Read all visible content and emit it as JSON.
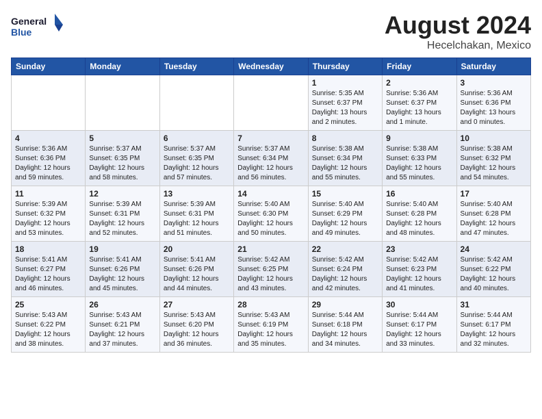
{
  "logo": {
    "line1": "General",
    "line2": "Blue"
  },
  "title": {
    "month_year": "August 2024",
    "location": "Hecelchakan, Mexico"
  },
  "days_of_week": [
    "Sunday",
    "Monday",
    "Tuesday",
    "Wednesday",
    "Thursday",
    "Friday",
    "Saturday"
  ],
  "weeks": [
    [
      {
        "day": "",
        "info": ""
      },
      {
        "day": "",
        "info": ""
      },
      {
        "day": "",
        "info": ""
      },
      {
        "day": "",
        "info": ""
      },
      {
        "day": "1",
        "info": "Sunrise: 5:35 AM\nSunset: 6:37 PM\nDaylight: 13 hours\nand 2 minutes."
      },
      {
        "day": "2",
        "info": "Sunrise: 5:36 AM\nSunset: 6:37 PM\nDaylight: 13 hours\nand 1 minute."
      },
      {
        "day": "3",
        "info": "Sunrise: 5:36 AM\nSunset: 6:36 PM\nDaylight: 13 hours\nand 0 minutes."
      }
    ],
    [
      {
        "day": "4",
        "info": "Sunrise: 5:36 AM\nSunset: 6:36 PM\nDaylight: 12 hours\nand 59 minutes."
      },
      {
        "day": "5",
        "info": "Sunrise: 5:37 AM\nSunset: 6:35 PM\nDaylight: 12 hours\nand 58 minutes."
      },
      {
        "day": "6",
        "info": "Sunrise: 5:37 AM\nSunset: 6:35 PM\nDaylight: 12 hours\nand 57 minutes."
      },
      {
        "day": "7",
        "info": "Sunrise: 5:37 AM\nSunset: 6:34 PM\nDaylight: 12 hours\nand 56 minutes."
      },
      {
        "day": "8",
        "info": "Sunrise: 5:38 AM\nSunset: 6:34 PM\nDaylight: 12 hours\nand 55 minutes."
      },
      {
        "day": "9",
        "info": "Sunrise: 5:38 AM\nSunset: 6:33 PM\nDaylight: 12 hours\nand 55 minutes."
      },
      {
        "day": "10",
        "info": "Sunrise: 5:38 AM\nSunset: 6:32 PM\nDaylight: 12 hours\nand 54 minutes."
      }
    ],
    [
      {
        "day": "11",
        "info": "Sunrise: 5:39 AM\nSunset: 6:32 PM\nDaylight: 12 hours\nand 53 minutes."
      },
      {
        "day": "12",
        "info": "Sunrise: 5:39 AM\nSunset: 6:31 PM\nDaylight: 12 hours\nand 52 minutes."
      },
      {
        "day": "13",
        "info": "Sunrise: 5:39 AM\nSunset: 6:31 PM\nDaylight: 12 hours\nand 51 minutes."
      },
      {
        "day": "14",
        "info": "Sunrise: 5:40 AM\nSunset: 6:30 PM\nDaylight: 12 hours\nand 50 minutes."
      },
      {
        "day": "15",
        "info": "Sunrise: 5:40 AM\nSunset: 6:29 PM\nDaylight: 12 hours\nand 49 minutes."
      },
      {
        "day": "16",
        "info": "Sunrise: 5:40 AM\nSunset: 6:28 PM\nDaylight: 12 hours\nand 48 minutes."
      },
      {
        "day": "17",
        "info": "Sunrise: 5:40 AM\nSunset: 6:28 PM\nDaylight: 12 hours\nand 47 minutes."
      }
    ],
    [
      {
        "day": "18",
        "info": "Sunrise: 5:41 AM\nSunset: 6:27 PM\nDaylight: 12 hours\nand 46 minutes."
      },
      {
        "day": "19",
        "info": "Sunrise: 5:41 AM\nSunset: 6:26 PM\nDaylight: 12 hours\nand 45 minutes."
      },
      {
        "day": "20",
        "info": "Sunrise: 5:41 AM\nSunset: 6:26 PM\nDaylight: 12 hours\nand 44 minutes."
      },
      {
        "day": "21",
        "info": "Sunrise: 5:42 AM\nSunset: 6:25 PM\nDaylight: 12 hours\nand 43 minutes."
      },
      {
        "day": "22",
        "info": "Sunrise: 5:42 AM\nSunset: 6:24 PM\nDaylight: 12 hours\nand 42 minutes."
      },
      {
        "day": "23",
        "info": "Sunrise: 5:42 AM\nSunset: 6:23 PM\nDaylight: 12 hours\nand 41 minutes."
      },
      {
        "day": "24",
        "info": "Sunrise: 5:42 AM\nSunset: 6:22 PM\nDaylight: 12 hours\nand 40 minutes."
      }
    ],
    [
      {
        "day": "25",
        "info": "Sunrise: 5:43 AM\nSunset: 6:22 PM\nDaylight: 12 hours\nand 38 minutes."
      },
      {
        "day": "26",
        "info": "Sunrise: 5:43 AM\nSunset: 6:21 PM\nDaylight: 12 hours\nand 37 minutes."
      },
      {
        "day": "27",
        "info": "Sunrise: 5:43 AM\nSunset: 6:20 PM\nDaylight: 12 hours\nand 36 minutes."
      },
      {
        "day": "28",
        "info": "Sunrise: 5:43 AM\nSunset: 6:19 PM\nDaylight: 12 hours\nand 35 minutes."
      },
      {
        "day": "29",
        "info": "Sunrise: 5:44 AM\nSunset: 6:18 PM\nDaylight: 12 hours\nand 34 minutes."
      },
      {
        "day": "30",
        "info": "Sunrise: 5:44 AM\nSunset: 6:17 PM\nDaylight: 12 hours\nand 33 minutes."
      },
      {
        "day": "31",
        "info": "Sunrise: 5:44 AM\nSunset: 6:17 PM\nDaylight: 12 hours\nand 32 minutes."
      }
    ]
  ]
}
